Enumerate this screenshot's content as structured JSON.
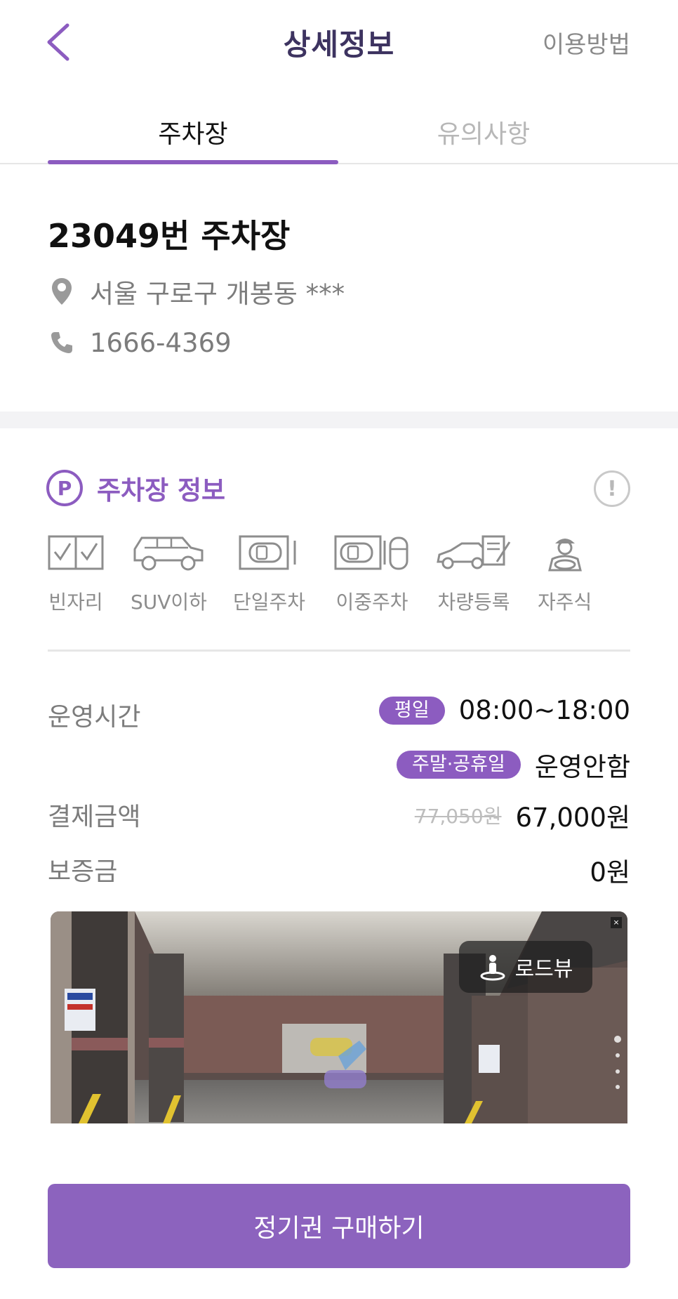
{
  "header": {
    "title": "상세정보",
    "howto_label": "이용방법"
  },
  "tabs": [
    {
      "label": "주차장",
      "active": true
    },
    {
      "label": "유의사항",
      "active": false
    }
  ],
  "lot": {
    "name": "23049번 주차장",
    "address": "서울 구로구 개봉동 ***",
    "phone": "1666-4369"
  },
  "parking_info": {
    "section_icon_letter": "P",
    "section_title": "주차장 정보",
    "info_icon_glyph": "!",
    "features": [
      {
        "label": "빈자리",
        "icon": "checkbox-slots-icon"
      },
      {
        "label": "SUV이하",
        "icon": "suv-icon"
      },
      {
        "label": "단일주차",
        "icon": "single-parking-icon"
      },
      {
        "label": "이중주차",
        "icon": "double-parking-icon"
      },
      {
        "label": "차량등록",
        "icon": "vehicle-registration-icon"
      },
      {
        "label": "자주식",
        "icon": "self-park-driver-icon"
      }
    ]
  },
  "details": {
    "hours_label": "운영시간",
    "weekday_badge": "평일",
    "weekday_hours": "08:00~18:00",
    "weekend_badge": "주말·공휴일",
    "weekend_status": "운영안함",
    "price_label": "결제금액",
    "original_price": "77,050원",
    "price": "67,000원",
    "deposit_label": "보증금",
    "deposit": "0원"
  },
  "roadview": {
    "button_label": "로드뷰",
    "close_glyph": "×"
  },
  "purchase_button_label": "정기권 구매하기",
  "colors": {
    "accent": "#8c5cc0",
    "button": "#8c63be",
    "title": "#3d3360",
    "muted": "#7c7c7c"
  }
}
